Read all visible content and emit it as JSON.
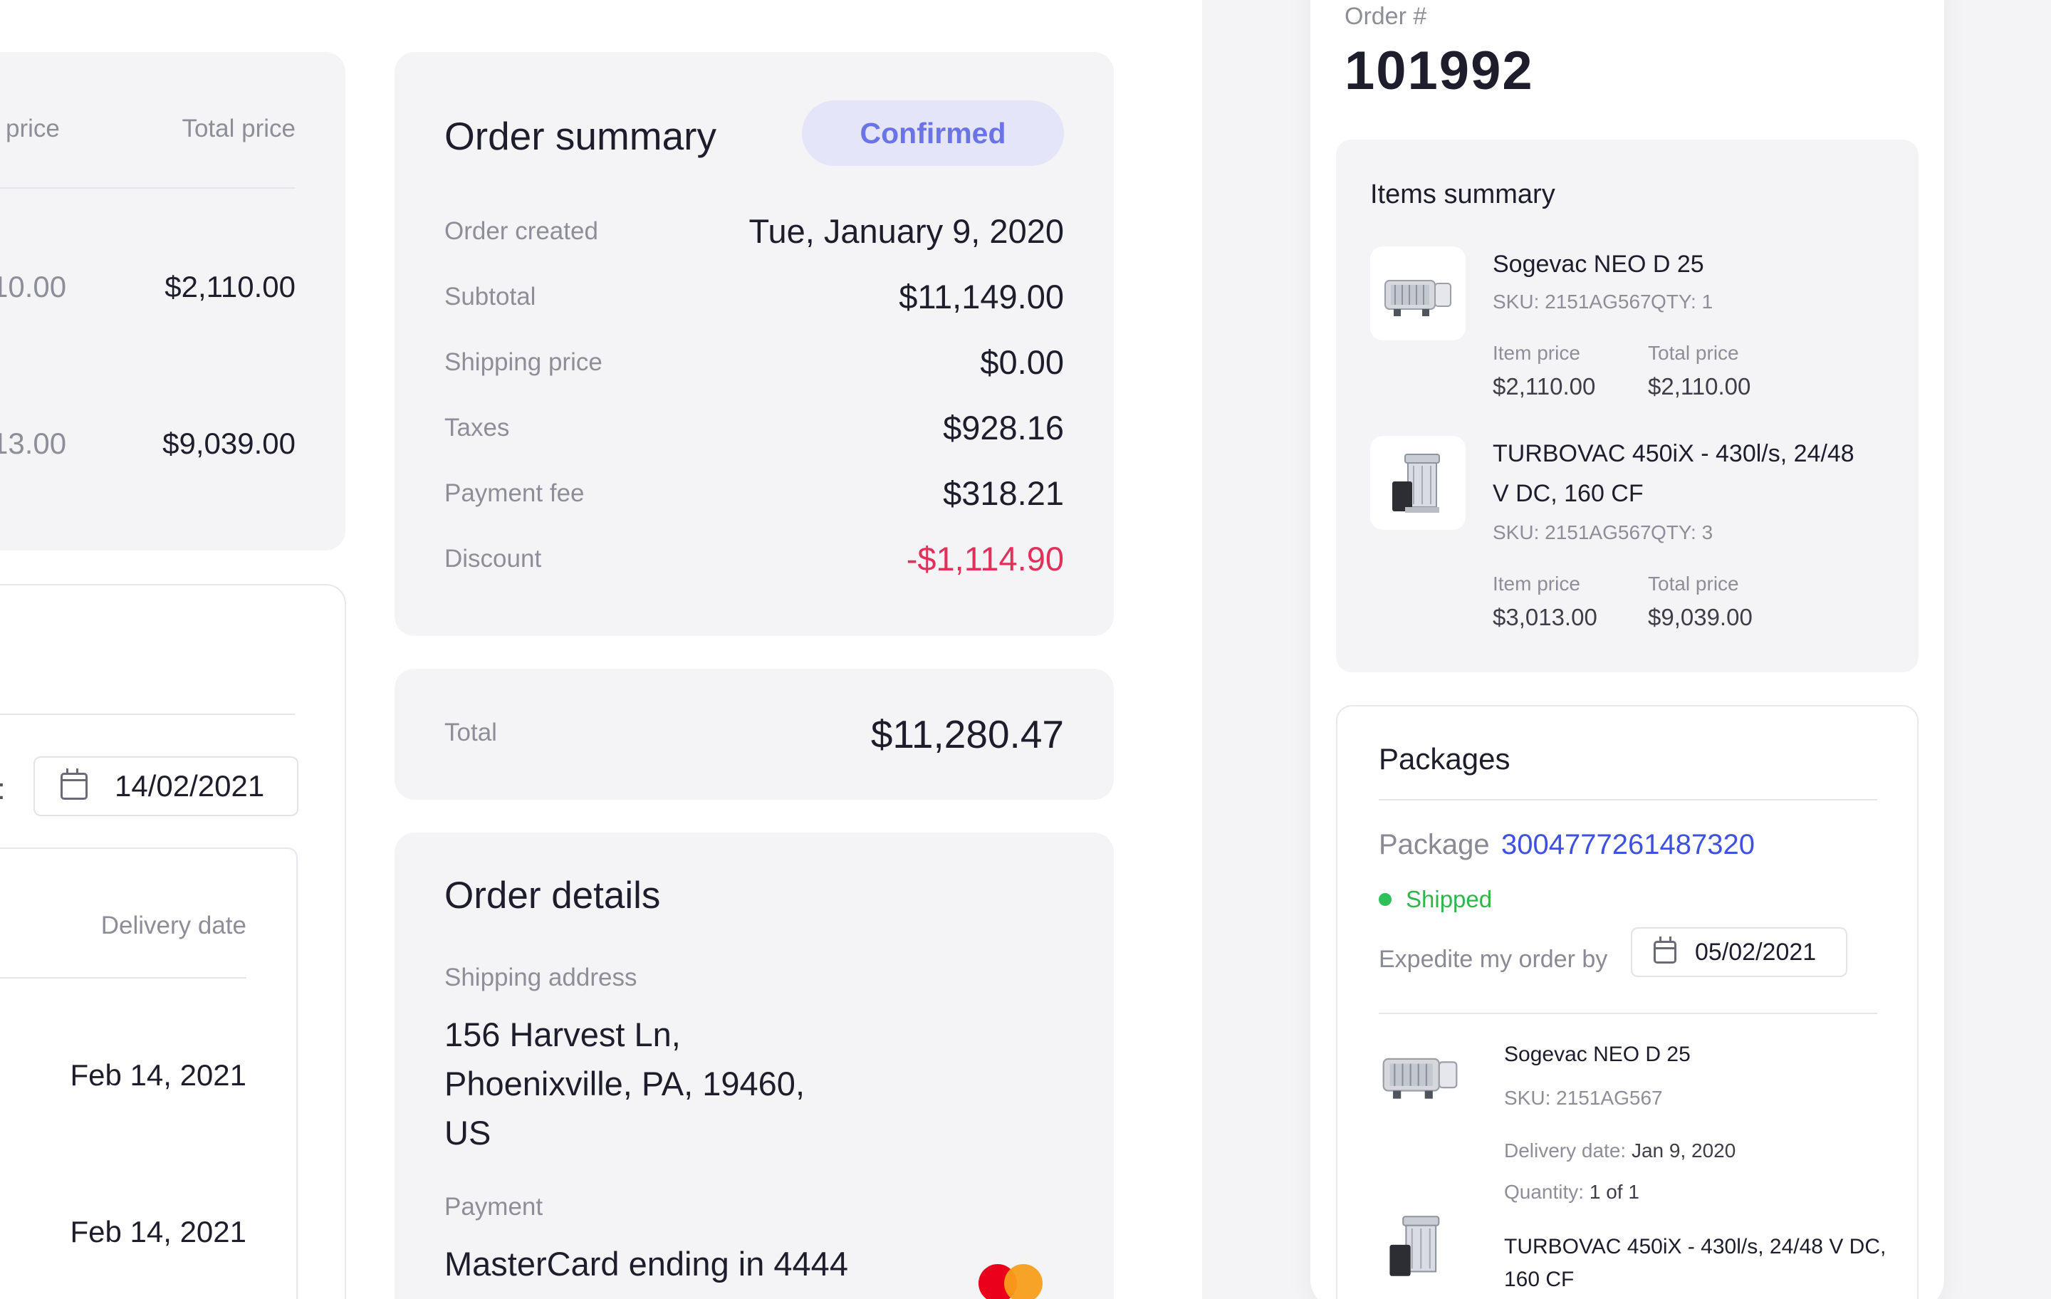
{
  "left_table": {
    "col_item_price_fragment": "price",
    "col_total_price": "Total price",
    "rows": [
      {
        "item_price_fragment": "10.00",
        "total_price": "$2,110.00"
      },
      {
        "item_price_fragment": "13.00",
        "total_price": "$9,039.00"
      }
    ]
  },
  "left_delivery": {
    "label_fragment": ":",
    "date_value": "14/02/2021",
    "col_delivery_date": "Delivery date",
    "rows": [
      "Feb 14, 2021",
      "Feb 14, 2021"
    ]
  },
  "order_summary": {
    "title": "Order summary",
    "status": "Confirmed",
    "rows": [
      {
        "label": "Order created",
        "value": "Tue, January 9, 2020"
      },
      {
        "label": "Subtotal",
        "value": "$11,149.00"
      },
      {
        "label": "Shipping price",
        "value": "$0.00"
      },
      {
        "label": "Taxes",
        "value": "$928.16"
      },
      {
        "label": "Payment fee",
        "value": "$318.21"
      },
      {
        "label": "Discount",
        "value": "-$1,114.90"
      }
    ]
  },
  "total": {
    "label": "Total",
    "value": "$11,280.47"
  },
  "order_details": {
    "title": "Order details",
    "shipping_label": "Shipping address",
    "address_line1": "156 Harvest Ln,",
    "address_line2": "Phoenixville, PA, 19460,",
    "address_line3": "US",
    "payment_label": "Payment",
    "payment_value": "MasterCard ending in 4444"
  },
  "mobile": {
    "order_label": "Order #",
    "order_number": "101992",
    "items_summary_title": "Items summary",
    "items": [
      {
        "name": "Sogevac NEO D 25",
        "sku": "SKU: 2151AG567",
        "qty": "QTY: 1",
        "item_price_label": "Item price",
        "item_price": "$2,110.00",
        "total_price_label": "Total price",
        "total_price": "$2,110.00",
        "icon": "pump-icon"
      },
      {
        "name_line1": "TURBOVAC 450iX - 430l/s, 24/48",
        "name_line2": "V DC, 160 CF",
        "sku": "SKU: 2151AG567",
        "qty": "QTY: 3",
        "item_price_label": "Item price",
        "item_price": "$3,013.00",
        "total_price_label": "Total price",
        "total_price": "$9,039.00",
        "icon": "turbo-pump-icon"
      }
    ],
    "packages": {
      "title": "Packages",
      "package_label": "Package",
      "package_id": "3004777261487320",
      "status": "Shipped",
      "expedite_label": "Expedite my order by",
      "expedite_date": "05/02/2021",
      "items": [
        {
          "name": "Sogevac NEO D 25",
          "sku": "SKU: 2151AG567",
          "delivery_label": "Delivery date:",
          "delivery_value": "Jan 9, 2020",
          "quantity_label": "Quantity:",
          "quantity_value": "1 of 1"
        },
        {
          "name_line1": "TURBOVAC 450iX - 430l/s, 24/48 V DC,",
          "name_line2": "160 CF"
        }
      ]
    }
  },
  "colors": {
    "accent": "#6b74e6",
    "status_bg": "#e4e5f8",
    "link": "#3f51e0",
    "discount": "#e0315a",
    "shipped": "#31b54d"
  }
}
